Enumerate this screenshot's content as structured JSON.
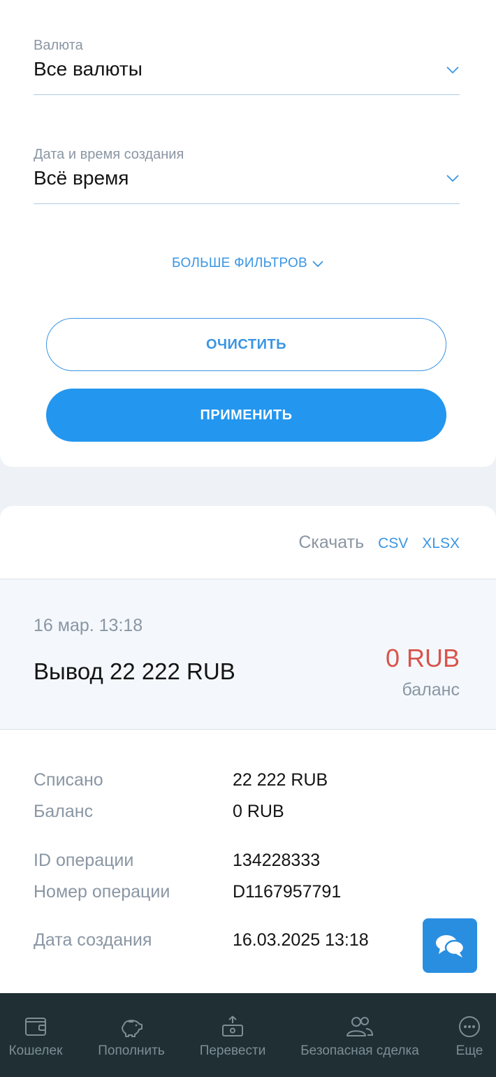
{
  "filters": {
    "currency": {
      "label": "Валюта",
      "value": "Все валюты"
    },
    "created": {
      "label": "Дата и время создания",
      "value": "Всё время"
    },
    "more_filters": "БОЛЬШЕ ФИЛЬТРОВ",
    "clear": "ОЧИСТИТЬ",
    "apply": "ПРИМЕНИТЬ"
  },
  "download": {
    "label": "Скачать",
    "csv": "CSV",
    "xlsx": "XLSX"
  },
  "transaction": {
    "date": "16 мар. 13:18",
    "title": "Вывод 22 222 RUB",
    "amount": "0 RUB",
    "amount_label": "баланс",
    "details": [
      {
        "key": "Списано",
        "value": "22 222 RUB"
      },
      {
        "key": "Баланс",
        "value": "0 RUB"
      },
      {
        "key": "ID операции",
        "value": "134228333"
      },
      {
        "key": "Номер операции",
        "value": "D1167957791"
      },
      {
        "key": "Дата создания",
        "value": "16.03.2025 13:18"
      }
    ]
  },
  "nav": {
    "wallet": "Кошелек",
    "topup": "Пополнить",
    "transfer": "Перевести",
    "safe_deal": "Безопасная сделка",
    "more": "Еще"
  },
  "colors": {
    "accent": "#2396ef",
    "negative": "#d9534a",
    "nav_bg": "#1f2f33",
    "muted": "#8a96a3"
  },
  "icons": [
    "chevron-down-icon",
    "chat-icon",
    "wallet-icon",
    "piggy-bank-icon",
    "transfer-icon",
    "users-icon",
    "more-icon"
  ]
}
